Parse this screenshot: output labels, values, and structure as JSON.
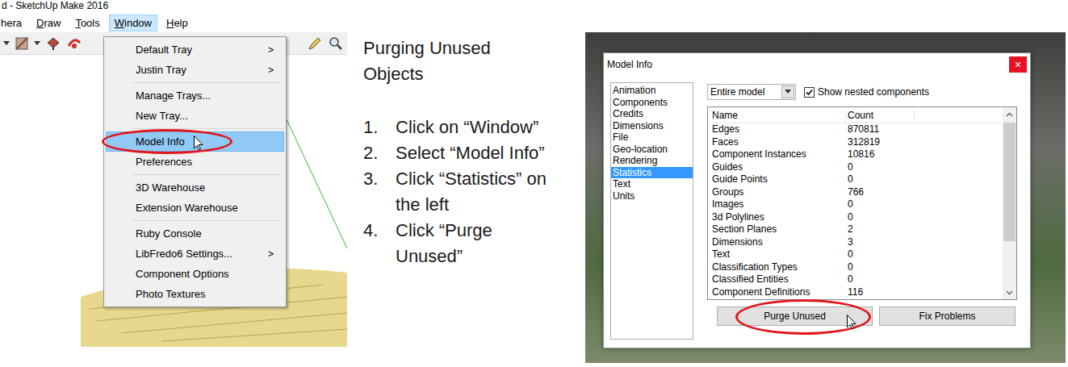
{
  "left_screenshot": {
    "title": "d - SketchUp Make 2016",
    "menubar": [
      {
        "label": "hera",
        "accelerator": "",
        "selected": false
      },
      {
        "label": "Draw",
        "accelerator": "D",
        "selected": false
      },
      {
        "label": "Tools",
        "accelerator": "T",
        "selected": false
      },
      {
        "label": "Window",
        "accelerator": "W",
        "selected": true
      },
      {
        "label": "Help",
        "accelerator": "H",
        "selected": false
      }
    ],
    "menu": {
      "groups": [
        [
          {
            "label": "Default Tray",
            "arrow": ">",
            "selected": false,
            "circled": false
          },
          {
            "label": "Justin Tray",
            "arrow": ">",
            "selected": false,
            "circled": false
          }
        ],
        [
          {
            "label": "Manage Trays...",
            "arrow": "",
            "selected": false,
            "circled": false
          },
          {
            "label": "New Tray...",
            "arrow": "",
            "selected": false,
            "circled": false
          }
        ],
        [
          {
            "label": "Model Info",
            "arrow": "",
            "selected": true,
            "circled": true
          },
          {
            "label": "Preferences",
            "arrow": "",
            "selected": false,
            "circled": false
          }
        ],
        [
          {
            "label": "3D Warehouse",
            "arrow": "",
            "selected": false,
            "circled": false
          },
          {
            "label": "Extension Warehouse",
            "arrow": "",
            "selected": false,
            "circled": false
          }
        ],
        [
          {
            "label": "Ruby Console",
            "arrow": "",
            "selected": false,
            "circled": false
          },
          {
            "label": "LibFredo6 Settings...",
            "arrow": ">",
            "selected": false,
            "circled": false
          },
          {
            "label": "Component Options",
            "arrow": "",
            "selected": false,
            "circled": false
          },
          {
            "label": "Photo Textures",
            "arrow": "",
            "selected": false,
            "circled": false
          }
        ]
      ]
    }
  },
  "instructions": {
    "heading": "Purging Unused Objects",
    "steps": [
      {
        "number": "1.",
        "text": "Click on “Window”"
      },
      {
        "number": "2.",
        "text": "Select “Model Info”"
      },
      {
        "number": "3.",
        "text": "Click “Statistics” on the left"
      },
      {
        "number": "4.",
        "text": "Click “Purge Unused”"
      }
    ]
  },
  "dialog": {
    "title": "Model Info",
    "close": "×",
    "categories": [
      {
        "label": "Animation",
        "selected": false
      },
      {
        "label": "Components",
        "selected": false
      },
      {
        "label": "Credits",
        "selected": false
      },
      {
        "label": "Dimensions",
        "selected": false
      },
      {
        "label": "File",
        "selected": false
      },
      {
        "label": "Geo-location",
        "selected": false
      },
      {
        "label": "Rendering",
        "selected": false
      },
      {
        "label": "Statistics",
        "selected": true
      },
      {
        "label": "Text",
        "selected": false
      },
      {
        "label": "Units",
        "selected": false
      }
    ],
    "scope": {
      "value": "Entire model"
    },
    "show_nested": {
      "label": "Show nested components",
      "checked": true
    },
    "table": {
      "columns": [
        "Name",
        "Count"
      ],
      "rows": [
        {
          "name": "Edges",
          "count": "870811"
        },
        {
          "name": "Faces",
          "count": "312819"
        },
        {
          "name": "Component Instances",
          "count": "10816"
        },
        {
          "name": "Guides",
          "count": "0"
        },
        {
          "name": "Guide Points",
          "count": "0"
        },
        {
          "name": "Groups",
          "count": "766"
        },
        {
          "name": "Images",
          "count": "0"
        },
        {
          "name": "3d Polylines",
          "count": "0"
        },
        {
          "name": "Section Planes",
          "count": "2"
        },
        {
          "name": "Dimensions",
          "count": "3"
        },
        {
          "name": "Text",
          "count": "0"
        },
        {
          "name": "Classification Types",
          "count": "0"
        },
        {
          "name": "Classified Entities",
          "count": "0"
        },
        {
          "name": "Component Definitions",
          "count": "116"
        }
      ]
    },
    "buttons": [
      {
        "label": "Purge Unused",
        "circled": true
      },
      {
        "label": "Fix Problems",
        "circled": false
      }
    ]
  }
}
